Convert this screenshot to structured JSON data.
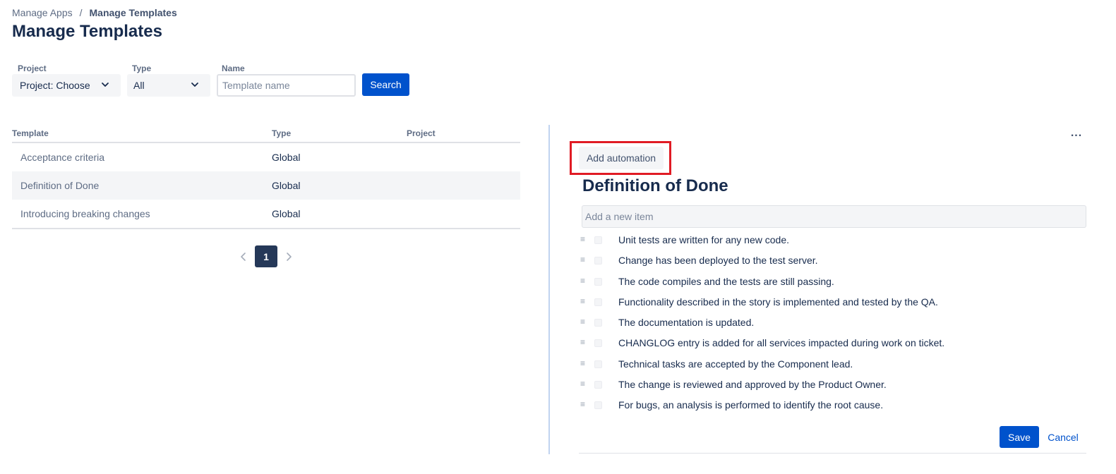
{
  "breadcrumb": {
    "parent": "Manage Apps",
    "separator": "/",
    "current": "Manage Templates"
  },
  "page": {
    "title": "Manage Templates"
  },
  "filters": {
    "project_label": "Project",
    "project_value": "Project: Choose",
    "type_label": "Type",
    "type_value": "All",
    "name_label": "Name",
    "name_placeholder": "Template name",
    "name_value": "",
    "search_label": "Search"
  },
  "table": {
    "columns": [
      "Template",
      "Type",
      "Project"
    ],
    "rows": [
      {
        "template": "Acceptance criteria",
        "type": "Global",
        "project": ""
      },
      {
        "template": "Definition of Done",
        "type": "Global",
        "project": ""
      },
      {
        "template": "Introducing breaking changes",
        "type": "Global",
        "project": ""
      }
    ],
    "selected_row": 1
  },
  "pagination": {
    "current_page": "1"
  },
  "detail": {
    "more_label": "...",
    "add_automation_label": "Add automation",
    "title": "Definition of Done",
    "new_item_placeholder": "Add a new item",
    "items": [
      "Unit tests are written for any new code.",
      "Change has been deployed to the test server.",
      "The code compiles and the tests are still passing.",
      "Functionality described in the story is implemented and tested by the QA.",
      "The documentation is updated.",
      "CHANGLOG entry is added for all services impacted during work on ticket.",
      "Technical tasks are accepted by the Component lead.",
      "The change is reviewed and approved by the Product Owner.",
      "For bugs, an analysis is performed to identify the root cause."
    ],
    "save_label": "Save",
    "cancel_label": "Cancel"
  },
  "icons": {
    "select_chevron": "chevron-down-icon",
    "drag_handle": "drag-handle-icon",
    "page_prev": "chevron-left-icon",
    "page_next": "chevron-right-icon"
  },
  "colors": {
    "primary": "#0052cc",
    "text": "#172b4d",
    "muted": "#5e6c84",
    "highlight": "#e01b24",
    "page_active": "#253858"
  }
}
